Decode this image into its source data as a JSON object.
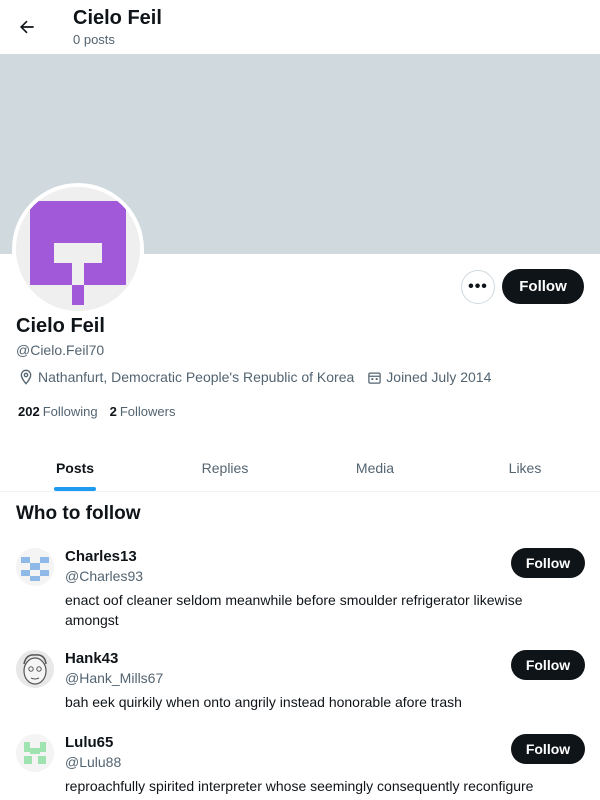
{
  "header": {
    "title": "Cielo Feil",
    "subtitle": "0 posts",
    "back_icon": "arrow-left-icon"
  },
  "profile": {
    "banner_color": "#cfd9de",
    "avatar_color": "#a259d9",
    "name": "Cielo Feil",
    "handle": "@Cielo.Feil70",
    "location": "Nathanfurt, Democratic People's Republic of Korea",
    "joined": "Joined July 2014",
    "following_count": "202",
    "following_label": "Following",
    "followers_count": "2",
    "followers_label": "Followers",
    "more_label": "•••",
    "follow_label": "Follow"
  },
  "tabs": [
    {
      "label": "Posts",
      "active": true
    },
    {
      "label": "Replies",
      "active": false
    },
    {
      "label": "Media",
      "active": false
    },
    {
      "label": "Likes",
      "active": false
    }
  ],
  "who_to_follow": {
    "title": "Who to follow",
    "users": [
      {
        "name": "Charles13",
        "handle": "@Charles93",
        "bio": "enact oof cleaner seldom meanwhile before smoulder refrigerator likewise amongst",
        "follow_label": "Follow",
        "avatar_color": "#8fb9e6"
      },
      {
        "name": "Hank43",
        "handle": "@Hank_Mills67",
        "bio": "bah eek quirkily when onto angrily instead honorable afore trash",
        "follow_label": "Follow",
        "avatar_color": "#555555"
      },
      {
        "name": "Lulu65",
        "handle": "@Lulu88",
        "bio": "reproachfully spirited interpreter whose seemingly consequently reconfigure",
        "follow_label": "Follow",
        "avatar_color": "#9fe3b0"
      }
    ]
  },
  "colors": {
    "accent": "#1d9bf0",
    "button_dark": "#0f1419",
    "text_secondary": "#536471"
  }
}
